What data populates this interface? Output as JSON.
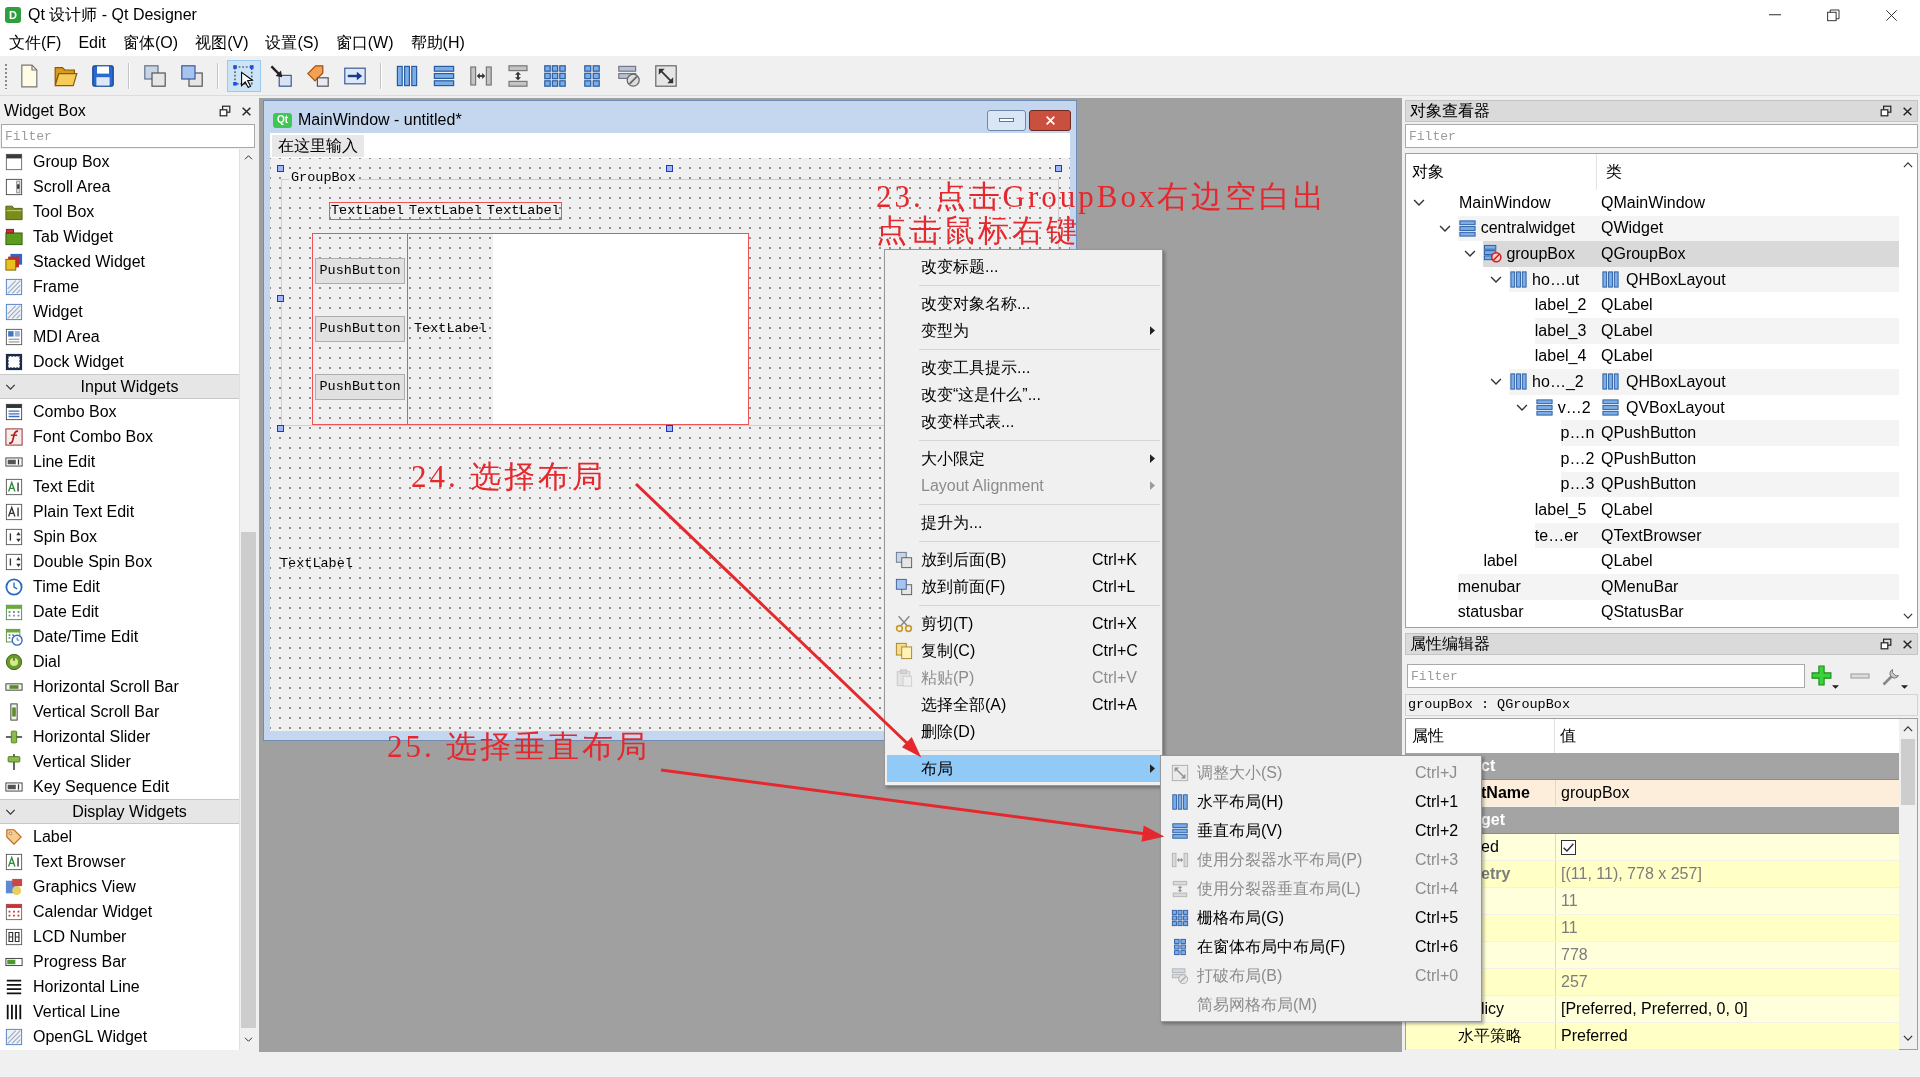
{
  "window": {
    "logo": "D",
    "title": "Qt 设计师 - Qt Designer"
  },
  "menu_bar": [
    "文件(F)",
    "Edit",
    "窗体(O)",
    "视图(V)",
    "设置(S)",
    "窗口(W)",
    "帮助(H)"
  ],
  "toolbar": {
    "groups": [
      [
        {
          "selected": false
        },
        {
          "selected": false
        },
        {
          "selected": false
        }
      ],
      [
        {
          "selected": false
        },
        {
          "selected": false
        }
      ],
      [
        {
          "selected": true
        },
        {
          "selected": false
        },
        {
          "selected": false
        },
        {
          "selected": false
        }
      ],
      [
        {
          "selected": false
        },
        {
          "selected": false
        },
        {
          "selected": false
        },
        {
          "selected": false
        },
        {
          "selected": false
        },
        {
          "selected": false
        },
        {
          "selected": false
        },
        {
          "selected": false
        }
      ]
    ]
  },
  "widget_box": {
    "title": "Widget Box",
    "filter": {
      "placeholder": "Filter"
    },
    "sections": [
      {
        "items": [
          "Group Box",
          "Scroll Area",
          "Tool Box",
          "Tab Widget",
          "Stacked Widget",
          "Frame",
          "Widget",
          "MDI Area",
          "Dock Widget"
        ]
      },
      {
        "title": "Input Widgets",
        "expanded": true,
        "items": [
          "Combo Box",
          "Font Combo Box",
          "Line Edit",
          "Text Edit",
          "Plain Text Edit",
          "Spin Box",
          "Double Spin Box",
          "Time Edit",
          "Date Edit",
          "Date/Time Edit",
          "Dial",
          "Horizontal Scroll Bar",
          "Vertical Scroll Bar",
          "Horizontal Slider",
          "Vertical Slider",
          "Key Sequence Edit"
        ]
      },
      {
        "title": "Display Widgets",
        "expanded": true,
        "items": [
          "Label",
          "Text Browser",
          "Graphics View",
          "Calendar Widget",
          "LCD Number",
          "Progress Bar",
          "Horizontal Line",
          "Vertical Line",
          "OpenGL Widget"
        ]
      }
    ]
  },
  "form_window": {
    "logo": "Qt",
    "title": "MainWindow - untitled*",
    "menu_hint": "在这里输入",
    "group_box": {
      "title": "GroupBox",
      "selected": true,
      "labels": [
        "TextLabel",
        "TextLabel",
        "TextLabel"
      ],
      "buttons": [
        "PushButton",
        "PushButton",
        "PushButton"
      ],
      "label": "TextLabel"
    },
    "label": "TextLabel"
  },
  "annotations": [
    {
      "lines": [
        "23. 点击GroupBox右边空白出",
        "点击鼠标右键"
      ]
    },
    {
      "lines": [
        "24. 选择布局"
      ]
    },
    {
      "lines": [
        "25. 选择垂直布局"
      ]
    }
  ],
  "context_menu": {
    "sections": [
      [
        {
          "label": "改变标题...",
          "submenu": false,
          "disabled": false,
          "selected": false
        }
      ],
      [
        {
          "label": "改变对象名称...",
          "submenu": false,
          "disabled": false,
          "selected": false
        },
        {
          "label": "变型为",
          "submenu": true,
          "disabled": false,
          "selected": false
        }
      ],
      [
        {
          "label": "改变工具提示...",
          "submenu": false,
          "disabled": false,
          "selected": false
        },
        {
          "label": "改变“这是什么”...",
          "submenu": false,
          "disabled": false,
          "selected": false
        },
        {
          "label": "改变样式表...",
          "submenu": false,
          "disabled": false,
          "selected": false
        }
      ],
      [
        {
          "label": "大小限定",
          "submenu": true,
          "disabled": false,
          "selected": false
        },
        {
          "label": "Layout Alignment",
          "submenu": true,
          "disabled": true,
          "selected": false
        }
      ],
      [
        {
          "label": "提升为...",
          "submenu": false,
          "disabled": false,
          "selected": false
        }
      ],
      [
        {
          "label": "放到后面(B)",
          "shortcut": "Ctrl+K",
          "submenu": false,
          "disabled": false,
          "selected": false
        },
        {
          "label": "放到前面(F)",
          "shortcut": "Ctrl+L",
          "submenu": false,
          "disabled": false,
          "selected": false
        }
      ],
      [
        {
          "label": "剪切(T)",
          "shortcut": "Ctrl+X",
          "submenu": false,
          "disabled": false,
          "selected": false
        },
        {
          "label": "复制(C)",
          "shortcut": "Ctrl+C",
          "submenu": false,
          "disabled": false,
          "selected": false
        },
        {
          "label": "粘贴(P)",
          "shortcut": "Ctrl+V",
          "submenu": false,
          "disabled": true,
          "selected": false
        },
        {
          "label": "选择全部(A)",
          "shortcut": "Ctrl+A",
          "submenu": false,
          "disabled": false,
          "selected": false
        },
        {
          "label": "删除(D)",
          "submenu": false,
          "disabled": false,
          "selected": false
        }
      ],
      [
        {
          "label": "布局",
          "submenu": true,
          "disabled": false,
          "selected": true
        }
      ]
    ]
  },
  "layout_submenu": {
    "items": [
      {
        "label": "调整大小(S)",
        "shortcut": "Ctrl+J",
        "disabled": true,
        "selected": false
      },
      {
        "label": "水平布局(H)",
        "shortcut": "Ctrl+1",
        "disabled": false,
        "selected": false
      },
      {
        "label": "垂直布局(V)",
        "shortcut": "Ctrl+2",
        "disabled": false,
        "selected": false
      },
      {
        "label": "使用分裂器水平布局(P)",
        "shortcut": "Ctrl+3",
        "disabled": true,
        "selected": false
      },
      {
        "label": "使用分裂器垂直布局(L)",
        "shortcut": "Ctrl+4",
        "disabled": true,
        "selected": false
      },
      {
        "label": "栅格布局(G)",
        "shortcut": "Ctrl+5",
        "disabled": false,
        "selected": false
      },
      {
        "label": "在窗体布局中布局(F)",
        "shortcut": "Ctrl+6",
        "disabled": false,
        "selected": false
      },
      {
        "label": "打破布局(B)",
        "shortcut": "Ctrl+0",
        "disabled": true,
        "selected": false
      },
      {
        "label": "简易网格布局(M)",
        "disabled": true,
        "selected": false
      }
    ]
  },
  "object_inspector": {
    "title": "对象查看器",
    "filter": {
      "placeholder": "Filter"
    },
    "columns": [
      "对象",
      "类"
    ],
    "tree": [
      {
        "name": "MainWindow",
        "class": "QMainWindow",
        "kind": "window",
        "expanded": true,
        "selected": false,
        "children": [
          {
            "name": "centralwidget",
            "class": "QWidget",
            "kind": "central",
            "expanded": true,
            "selected": false,
            "children": [
              {
                "name": "groupBox",
                "class": "QGroupBox",
                "kind": "group",
                "expanded": true,
                "selected": true,
                "children": [
                  {
                    "name": "ho…ut",
                    "class": "QHBoxLayout",
                    "kind": "hbox",
                    "expanded": true,
                    "selected": false,
                    "children": [
                      {
                        "name": "label_2",
                        "class": "QLabel",
                        "selected": false
                      },
                      {
                        "name": "label_3",
                        "class": "QLabel",
                        "selected": false
                      },
                      {
                        "name": "label_4",
                        "class": "QLabel",
                        "selected": false
                      }
                    ]
                  },
                  {
                    "name": "ho…_2",
                    "class": "QHBoxLayout",
                    "kind": "hbox",
                    "expanded": true,
                    "selected": false,
                    "children": [
                      {
                        "name": "v…2",
                        "class": "QVBoxLayout",
                        "kind": "vbox",
                        "expanded": true,
                        "selected": false,
                        "children": [
                          {
                            "name": "p…n",
                            "class": "QPushButton",
                            "selected": false
                          },
                          {
                            "name": "p…2",
                            "class": "QPushButton",
                            "selected": false
                          },
                          {
                            "name": "p…3",
                            "class": "QPushButton",
                            "selected": false
                          }
                        ]
                      },
                      {
                        "name": "label_5",
                        "class": "QLabel",
                        "selected": false
                      },
                      {
                        "name": "te…er",
                        "class": "QTextBrowser",
                        "selected": false
                      }
                    ]
                  }
                ]
              },
              {
                "name": "label",
                "class": "QLabel",
                "selected": false
              }
            ]
          },
          {
            "name": "menubar",
            "class": "QMenuBar",
            "selected": false
          },
          {
            "name": "statusbar",
            "class": "QStatusBar",
            "selected": false
          }
        ]
      }
    ]
  },
  "property_editor": {
    "title": "属性编辑器",
    "filter": {
      "placeholder": "Filter"
    },
    "object": "groupBox : QGroupBox",
    "columns": [
      "属性",
      "值"
    ],
    "groups": [
      {
        "name": "ct",
        "properties": [
          {
            "name": "tName",
            "kind": "text",
            "value": "groupBox",
            "changed": true,
            "disabled": false
          }
        ]
      },
      {
        "name": "get",
        "properties": [
          {
            "name": "ed",
            "kind": "checkbox",
            "checked": true,
            "changed": false,
            "disabled": false
          },
          {
            "name": "etry",
            "kind": "text",
            "value": "[(11, 11), 778 x 257]",
            "changed": true,
            "disabled": true,
            "children": [
              {
                "kind": "text",
                "value": "11",
                "disabled": true
              },
              {
                "kind": "text",
                "value": "11",
                "disabled": true
              },
              {
                "kind": "text",
                "value": "778",
                "disabled": true
              },
              {
                "kind": "text",
                "value": "257",
                "disabled": true
              }
            ]
          },
          {
            "name": "licy",
            "kind": "text",
            "value": "[Preferred, Preferred, 0, 0]",
            "changed": false,
            "disabled": false,
            "children": [
              {
                "name": "水平策略",
                "kind": "text",
                "value": "Preferred",
                "changed": false,
                "disabled": false
              }
            ]
          }
        ]
      }
    ]
  }
}
